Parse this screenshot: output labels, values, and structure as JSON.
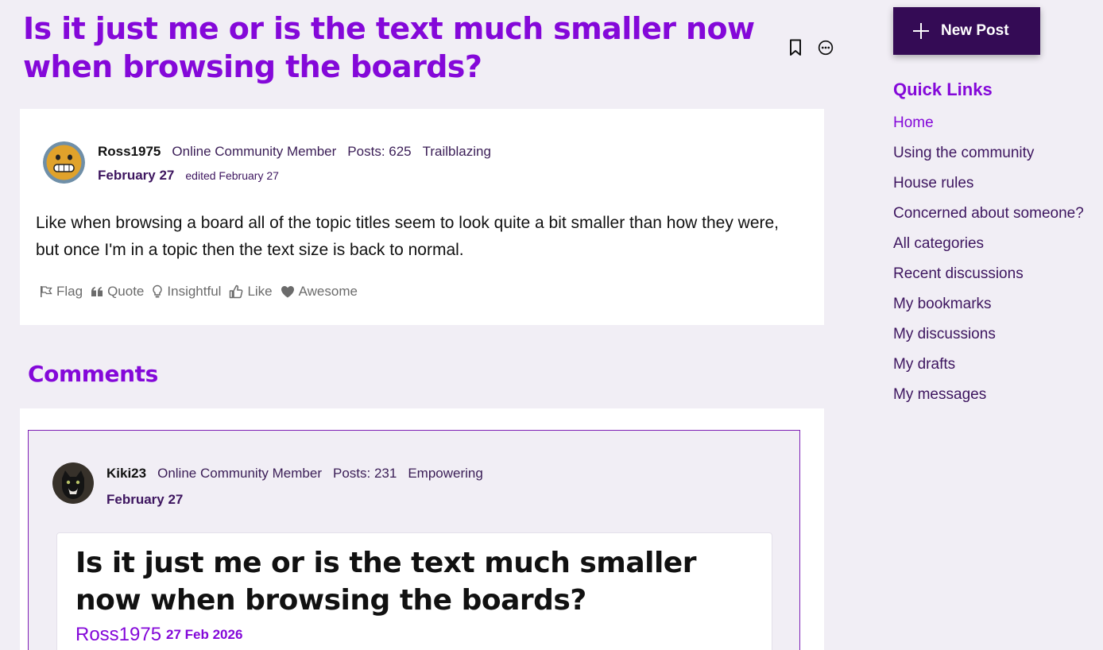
{
  "topic": {
    "title": "Is it just me or is the text much smaller now when browsing the boards?"
  },
  "post": {
    "author": "Ross1975",
    "role": "Online Community Member",
    "posts": "Posts: 625",
    "rank": "Trailblazing",
    "date": "February 27",
    "edited": "edited February 27",
    "body": "Like when browsing a board all of the topic titles seem to look quite a bit smaller than how they were, but once I'm in a topic then the text size is back to normal.",
    "reactions": {
      "flag": "Flag",
      "quote": "Quote",
      "insightful": "Insightful",
      "like": "Like",
      "awesome": "Awesome"
    }
  },
  "comments": {
    "heading": "Comments",
    "items": [
      {
        "author": "Kiki23",
        "role": "Online Community Member",
        "posts": "Posts: 231",
        "rank": "Empowering",
        "date": "February 27",
        "quote": {
          "title": "Is it just me or is the text much smaller now when browsing the boards?",
          "author": "Ross1975",
          "date": "27 Feb 2026"
        }
      }
    ]
  },
  "sidebar": {
    "new_post_label": "New Post",
    "quick_links_title": "Quick Links",
    "links": [
      "Home",
      "Using the community",
      "House rules",
      "Concerned about someone?",
      "All categories",
      "Recent discussions",
      "My bookmarks",
      "My discussions",
      "My drafts",
      "My messages"
    ]
  },
  "icons": {
    "bookmark": "bookmark-icon",
    "options": "more-options-icon",
    "flag": "flag-icon",
    "quote": "quote-icon",
    "insightful": "lightbulb-icon",
    "like": "thumbs-up-icon",
    "awesome": "heart-icon",
    "new_post": "plus-icon"
  },
  "colors": {
    "accent": "#8408d9",
    "dark_accent": "#340b55",
    "background": "#f1eef5"
  }
}
